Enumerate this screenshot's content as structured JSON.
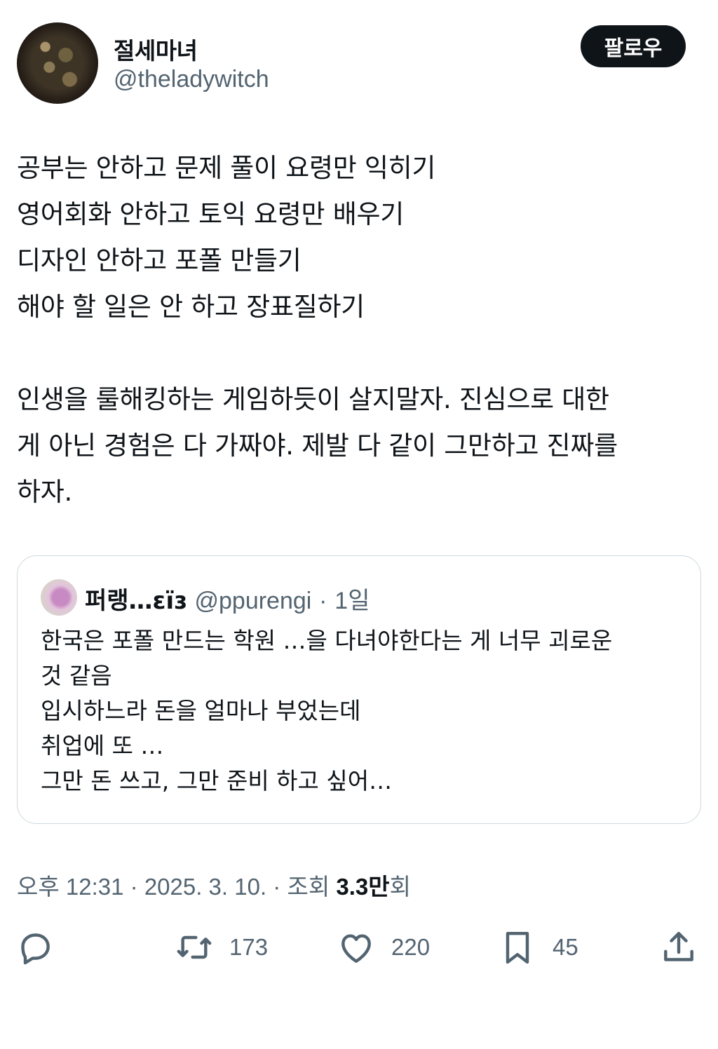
{
  "author": {
    "display_name": "절세마녀",
    "handle": "@theladywitch",
    "follow_label": "팔로우"
  },
  "tweet": {
    "lines": [
      "공부는 안하고 문제 풀이 요령만 익히기",
      "영어회화 안하고 토익 요령만 배우기",
      "디자인 안하고 포폴 만들기",
      "해야 할 일은 안 하고 장표질하기"
    ],
    "paragraph2": [
      "인생을 룰해킹하는 게임하듯이 살지말자. 진심으로 대한",
      "게 아닌 경험은 다 가짜야. 제발 다 같이 그만하고 진짜를",
      "하자."
    ]
  },
  "quote": {
    "name": "퍼랭…ɛïɜ",
    "handle": "@ppurengi",
    "separator": "·",
    "time": "1일",
    "lines": [
      "한국은 포폴 만드는 학원 …을 다녀야한다는 게 너무 괴로운",
      "것 같음",
      "입시하느라 돈을 얼마나 부었는데",
      "취업에 또 …",
      "그만 돈 쓰고, 그만 준비 하고 싶어…"
    ]
  },
  "meta": {
    "time": "오후 12:31",
    "sep1": " · ",
    "date": "2025. 3. 10.",
    "sep2": " · ",
    "views_label": "조회 ",
    "views_count": "3.3만",
    "views_suffix": "회"
  },
  "actions": {
    "reply_icon": "reply-icon",
    "retweet_icon": "retweet-icon",
    "retweet_count": "173",
    "like_icon": "heart-icon",
    "like_count": "220",
    "bookmark_icon": "bookmark-icon",
    "bookmark_count": "45",
    "share_icon": "share-icon"
  }
}
